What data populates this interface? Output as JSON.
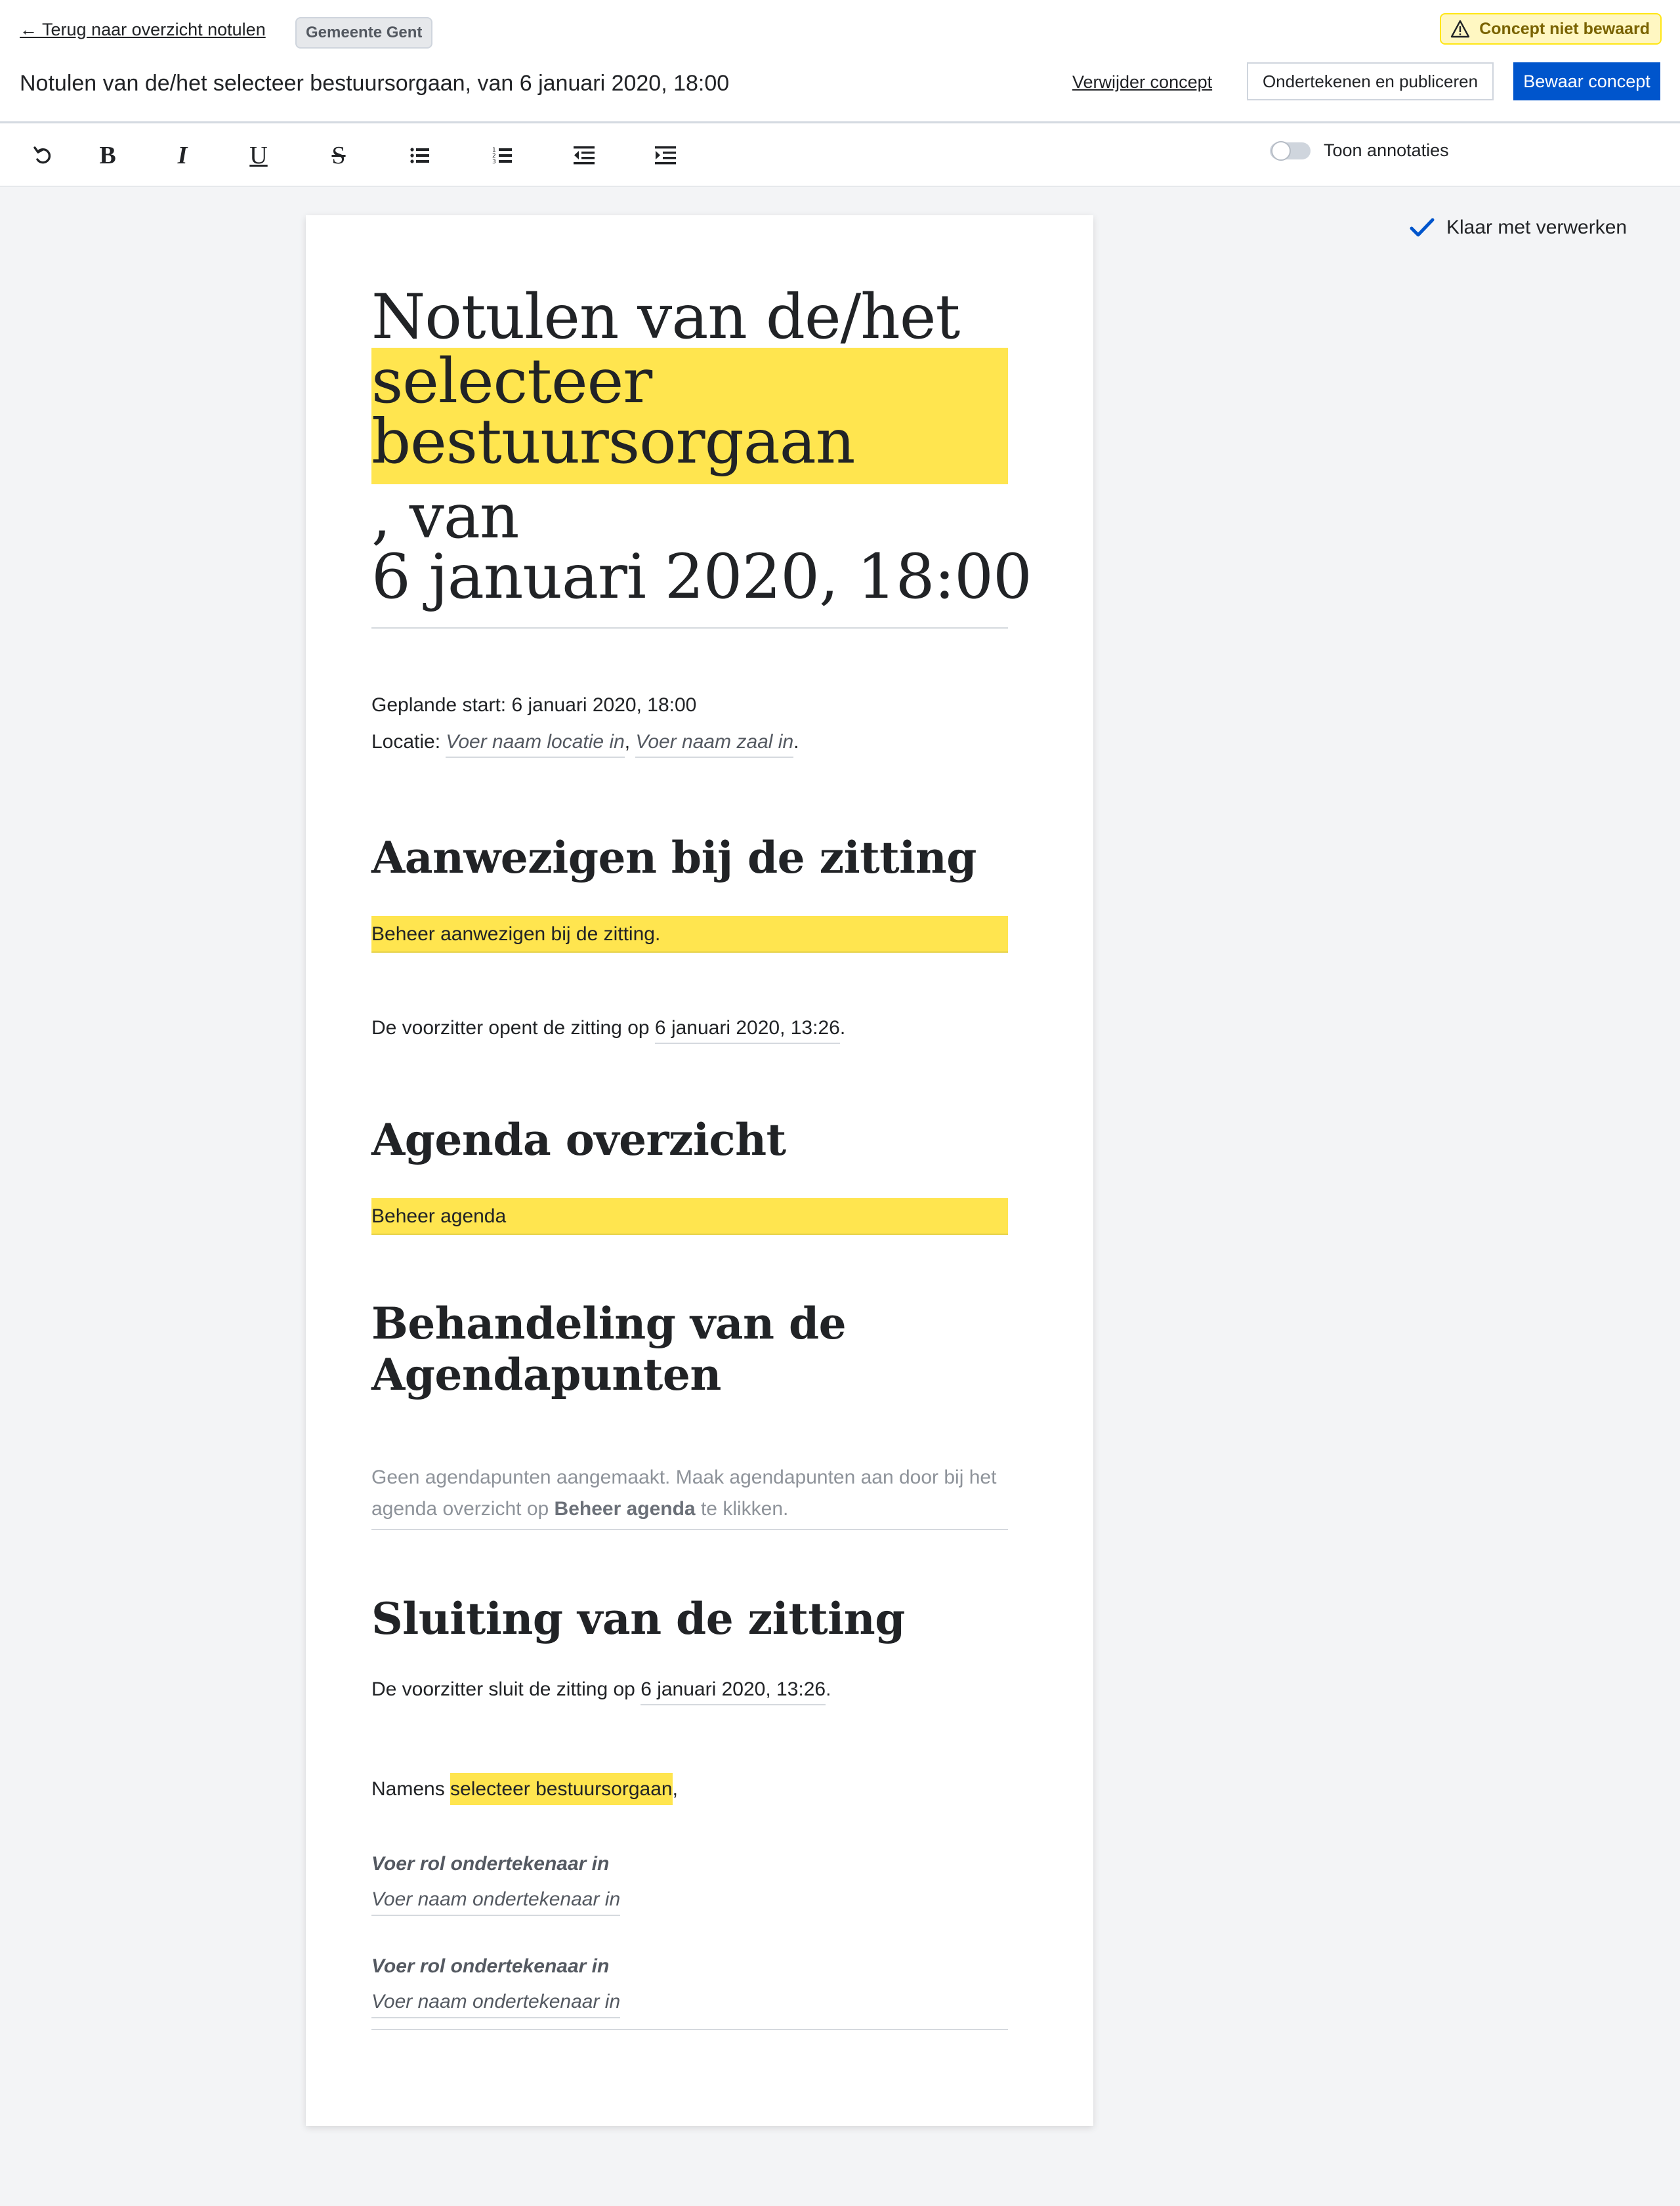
{
  "header": {
    "back_label": "← Terug naar overzicht notulen",
    "org_label": "Gemeente Gent",
    "title": "Notulen van de/het selecteer bestuursorgaan, van 6 januari 2020, 18:00",
    "status_label": "Concept niet bewaard",
    "delete_label": "Verwijder concept",
    "sign_label": "Ondertekenen en publiceren",
    "save_label": "Bewaar concept"
  },
  "toolbar": {
    "bold": "B",
    "italic": "I",
    "underline": "U",
    "strike": "S",
    "annotations_label": "Toon annotaties",
    "annotations_on": false
  },
  "status": {
    "ready_label": "Klaar met verwerken"
  },
  "document": {
    "title_line1": "Notulen van de/het",
    "title_hl1": "selecteer",
    "title_hl2": "bestuursorgaan",
    "title_line3": ", van",
    "title_line4": "6 januari 2020, 18:00",
    "planned_start": "Geplande start: 6 januari 2020, 18:00",
    "location_prefix": "Locatie: ",
    "location_placeholder": "Voer naam locatie in",
    "location_sep": ", ",
    "room_placeholder": "Voer naam zaal in",
    "location_end": ".",
    "section_present": "Aanwezigen bij de zitting",
    "manage_present": "Beheer aanwezigen bij de zitting.",
    "opens_prefix": "De voorzitter opent de zitting op ",
    "opens_time": "6 januari 2020, 13:26",
    "opens_end": ".",
    "section_agenda": "Agenda overzicht",
    "manage_agenda": "Beheer agenda",
    "section_treatment": "Behandeling van de Agendapunten",
    "no_items_pre": "Geen agendapunten aangemaakt. Maak agendapunten aan door bij het agenda overzicht op ",
    "no_items_bold": "Beheer agenda",
    "no_items_post": " te klikken.",
    "section_closing": "Sluiting van de zitting",
    "closes_prefix": "De voorzitter sluit de zitting op ",
    "closes_time": "6 januari 2020, 13:26",
    "closes_end": ".",
    "on_behalf_prefix": "Namens ",
    "on_behalf_body": "selecteer bestuursorgaan",
    "on_behalf_end": ",",
    "signers": [
      {
        "role": "Voer rol ondertekenaar in",
        "name": "Voer naam ondertekenaar in"
      },
      {
        "role": "Voer rol ondertekenaar in",
        "name": "Voer naam ondertekenaar in"
      }
    ]
  },
  "colors": {
    "primary": "#0055cc",
    "highlight": "#ffe54f",
    "warning_bg": "#fff7c2",
    "check": "#0055cc"
  },
  "icons": [
    "undo-icon",
    "bold-icon",
    "italic-icon",
    "underline-icon",
    "strikethrough-icon",
    "bullet-list-icon",
    "numbered-list-icon",
    "outdent-icon",
    "indent-icon",
    "warning-icon",
    "check-icon"
  ]
}
